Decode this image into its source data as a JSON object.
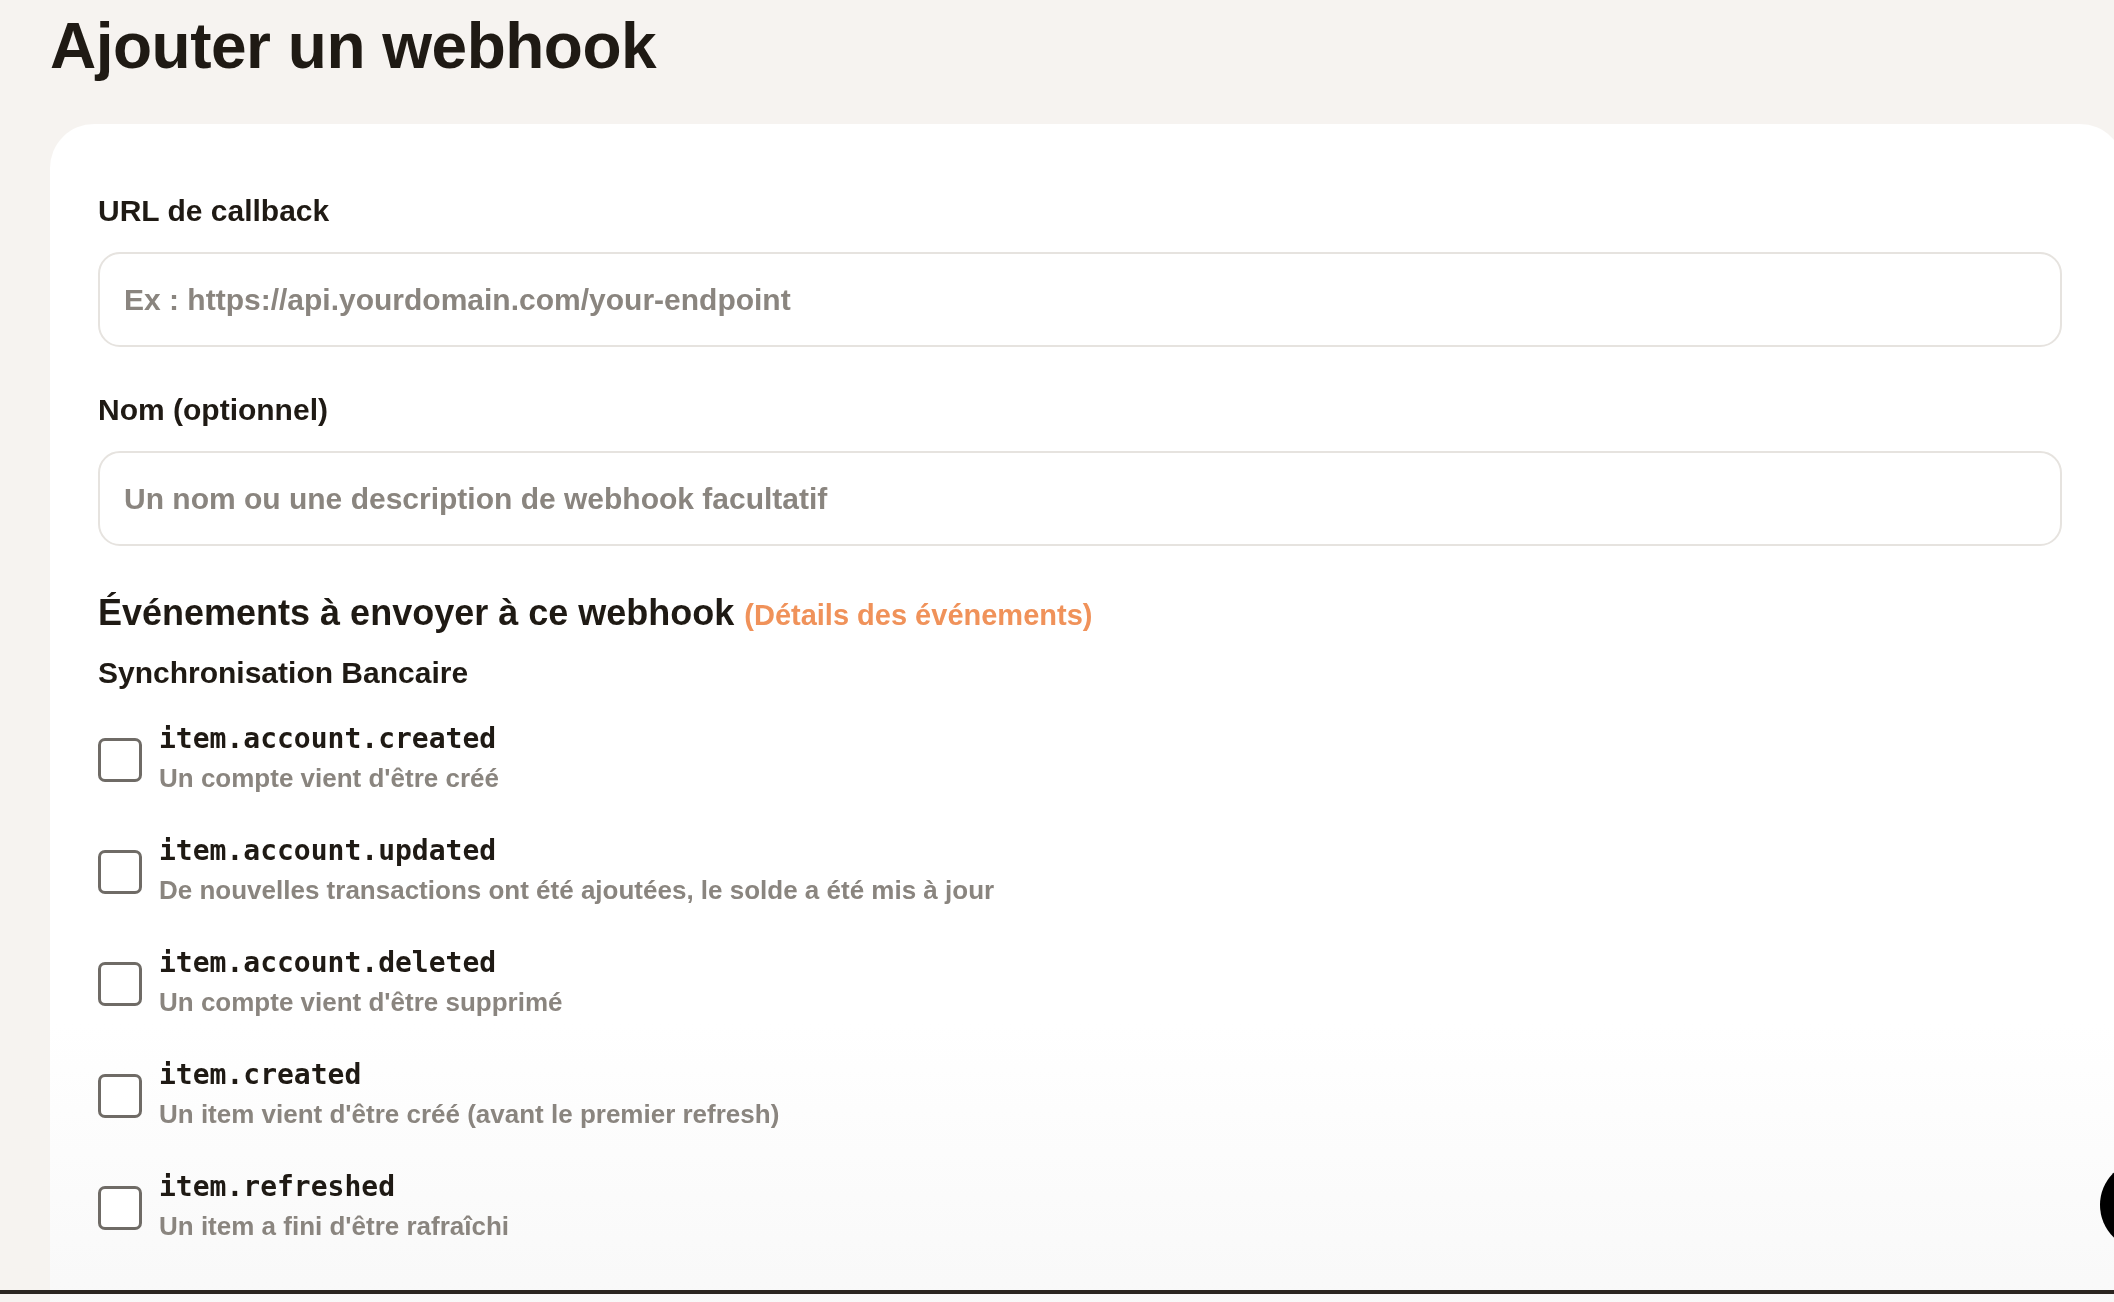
{
  "title": "Ajouter un webhook",
  "fields": [
    {
      "label": "URL de callback",
      "placeholder": "Ex : https://api.yourdomain.com/your-endpoint"
    },
    {
      "label": "Nom (optionnel)",
      "placeholder": "Un nom ou une description de webhook facultatif"
    }
  ],
  "events_heading": "Événements à envoyer à ce webhook",
  "events_link": "(Détails des événements)",
  "group": "Synchronisation Bancaire",
  "events": [
    {
      "name": "item.account.created",
      "description": "Un compte vient d'être créé",
      "checked": false
    },
    {
      "name": "item.account.updated",
      "description": "De nouvelles transactions ont été ajoutées, le solde a été mis à jour",
      "checked": false
    },
    {
      "name": "item.account.deleted",
      "description": "Un compte vient d'être supprimé",
      "checked": false
    },
    {
      "name": "item.created",
      "description": "Un item vient d'être créé (avant le premier refresh)",
      "checked": false
    },
    {
      "name": "item.refreshed",
      "description": "Un item a fini d'être rafraîchi",
      "checked": false
    }
  ]
}
